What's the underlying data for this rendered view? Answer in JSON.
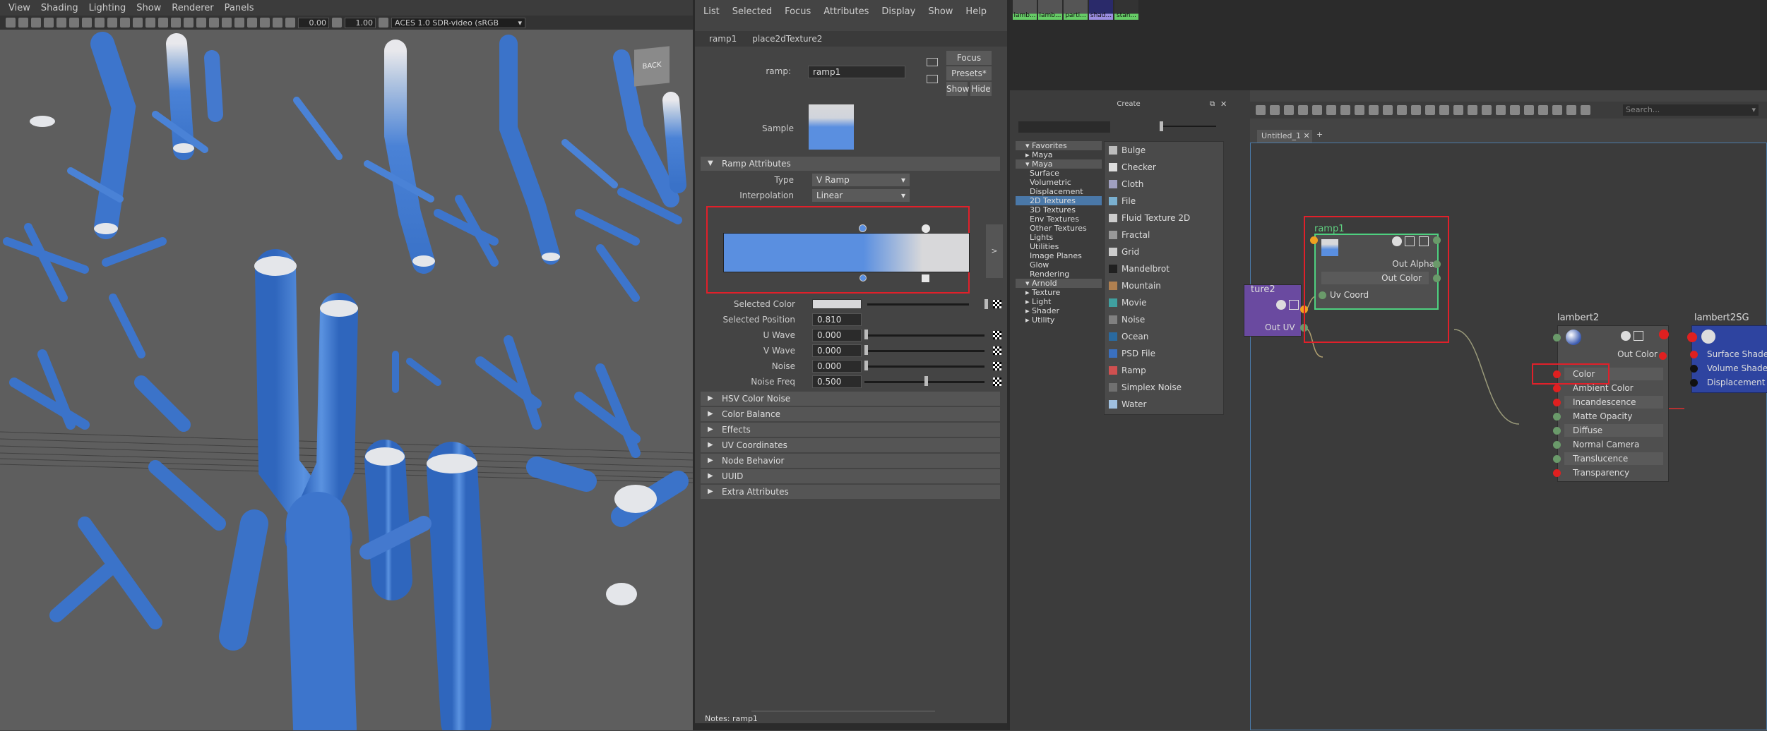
{
  "viewport": {
    "menu": [
      "View",
      "Shading",
      "Lighting",
      "Show",
      "Renderer",
      "Panels"
    ],
    "exposure": "0.00",
    "gamma": "1.00",
    "colorspace": "ACES 1.0 SDR-video (sRGB",
    "viewcube_label": "BACK"
  },
  "attribute_editor": {
    "menu": [
      "List",
      "Selected",
      "Focus",
      "Attributes",
      "Display",
      "Show",
      "Help"
    ],
    "tabs": [
      "ramp1",
      "place2dTexture2"
    ],
    "ramp_label": "ramp:",
    "ramp_name": "ramp1",
    "focus_btn": "Focus",
    "presets_btn": "Presets*",
    "show_btn": "Show",
    "hide_btn": "Hide",
    "sample_label": "Sample",
    "section_ramp": "Ramp Attributes",
    "type_label": "Type",
    "type_value": "V Ramp",
    "interp_label": "Interpolation",
    "interp_value": "Linear",
    "expand_btn": ">",
    "selected_color_label": "Selected Color",
    "selected_position_label": "Selected Position",
    "selected_position": "0.810",
    "u_wave_label": "U Wave",
    "u_wave": "0.000",
    "v_wave_label": "V Wave",
    "v_wave": "0.000",
    "noise_label": "Noise",
    "noise": "0.000",
    "noise_freq_label": "Noise Freq",
    "noise_freq": "0.500",
    "sections": [
      "HSV Color Noise",
      "Color Balance",
      "Effects",
      "UV Coordinates",
      "Node Behavior",
      "UUID",
      "Extra Attributes"
    ],
    "notes": "Notes:  ramp1"
  },
  "hypershade": {
    "thumbs": [
      "lamb...",
      "lamb...",
      "parti...",
      "shad...",
      "stan..."
    ],
    "create_title": "Create",
    "tree": {
      "favorites": "Favorites",
      "favorites_children": [
        "Maya"
      ],
      "maya": "Maya",
      "maya_children": [
        "Surface",
        "Volumetric",
        "Displacement",
        "2D Textures",
        "3D Textures",
        "Env Textures",
        "Other Textures",
        "Lights",
        "Utilities",
        "Image Planes",
        "Glow",
        "Rendering"
      ],
      "arnold": "Arnold",
      "arnold_children": [
        "Texture",
        "Light",
        "Shader",
        "Utility"
      ]
    },
    "create_items": [
      {
        "label": "Bulge",
        "color": "#bbbbbb"
      },
      {
        "label": "Checker",
        "color": "#dddddd"
      },
      {
        "label": "Cloth",
        "color": "#a0a0c0"
      },
      {
        "label": "File",
        "color": "#7ab0d0"
      },
      {
        "label": "Fluid Texture 2D",
        "color": "#cccccc"
      },
      {
        "label": "Fractal",
        "color": "#999999"
      },
      {
        "label": "Grid",
        "color": "#cccccc"
      },
      {
        "label": "Mandelbrot",
        "color": "#202020"
      },
      {
        "label": "Mountain",
        "color": "#b08050"
      },
      {
        "label": "Movie",
        "color": "#40a0a0"
      },
      {
        "label": "Noise",
        "color": "#808080"
      },
      {
        "label": "Ocean",
        "color": "#2a6aa0"
      },
      {
        "label": "PSD File",
        "color": "#3a70c0"
      },
      {
        "label": "Ramp",
        "color": "#d05050"
      },
      {
        "label": "Simplex Noise",
        "color": "#707070"
      },
      {
        "label": "Water",
        "color": "#a0c0e0"
      }
    ],
    "search_placeholder": "Search...",
    "graph_tab": "Untitled_1",
    "graph_tab_close": "✕",
    "graph_tab_add": "+",
    "nodes": {
      "place2d": {
        "title": "ture2",
        "out": "Out UV"
      },
      "ramp": {
        "title": "ramp1",
        "out_alpha": "Out Alpha",
        "out_color": "Out Color",
        "uv": "Uv Coord"
      },
      "lambert": {
        "title": "lambert2",
        "out_color": "Out Color",
        "inputs": [
          "Color",
          "Ambient Color",
          "Incandescence",
          "Matte Opacity",
          "Diffuse",
          "Normal Camera",
          "Translucence",
          "Transparency"
        ]
      },
      "sg": {
        "title": "lambert2SG",
        "inputs": [
          "Surface Shader",
          "Volume Shader",
          "Displacement"
        ]
      }
    }
  }
}
